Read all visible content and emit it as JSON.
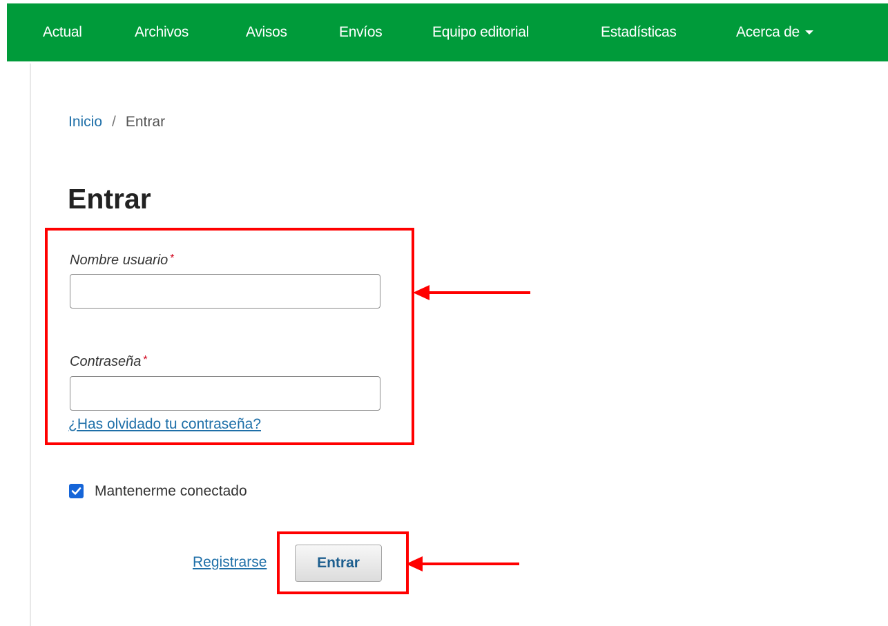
{
  "nav": {
    "items": [
      {
        "label": "Actual"
      },
      {
        "label": "Archivos"
      },
      {
        "label": "Avisos"
      },
      {
        "label": "Envíos"
      },
      {
        "label": "Equipo editorial"
      },
      {
        "label": "Estadísticas"
      },
      {
        "label": "Acerca de",
        "has_dropdown": true
      }
    ],
    "background_color": "#009b3a"
  },
  "breadcrumb": {
    "home": "Inicio",
    "separator": "/",
    "current": "Entrar"
  },
  "page_title": "Entrar",
  "login_form": {
    "username_label": "Nombre usuario",
    "username_value": "",
    "password_label": "Contraseña",
    "password_value": "",
    "required_marker": "*",
    "forgot_password": "¿Has olvidado tu contraseña?",
    "remember_me_label": "Mantenerme conectado",
    "remember_me_checked": true,
    "register_link": "Registrarse",
    "submit_label": "Entrar"
  },
  "annotations": {
    "highlight_color": "#ff0000",
    "highlights": [
      "credential-fields",
      "submit-button"
    ]
  }
}
